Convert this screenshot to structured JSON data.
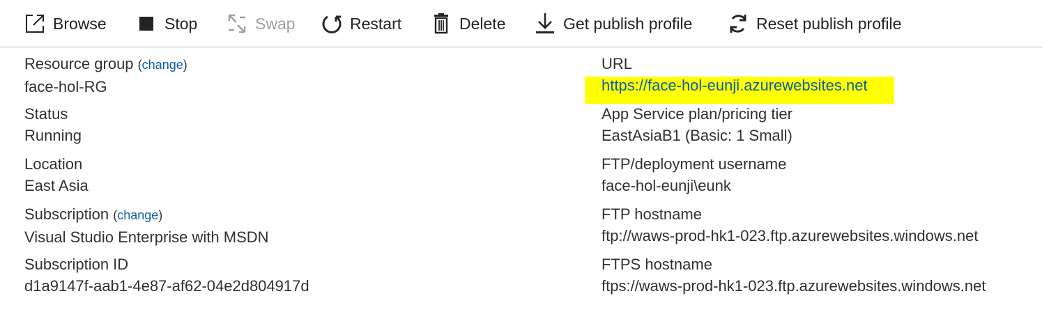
{
  "toolbar": {
    "browse": "Browse",
    "stop": "Stop",
    "swap": "Swap",
    "restart": "Restart",
    "delete": "Delete",
    "get_publish_profile": "Get publish profile",
    "reset_publish_profile": "Reset publish profile"
  },
  "essentials": {
    "left": {
      "resource_group_label": "Resource group",
      "resource_group_change": "change",
      "resource_group_value": "face-hol-RG",
      "status_label": "Status",
      "status_value": "Running",
      "location_label": "Location",
      "location_value": "East Asia",
      "subscription_label": "Subscription",
      "subscription_change": "change",
      "subscription_value": "Visual Studio Enterprise with MSDN",
      "subscription_id_label": "Subscription ID",
      "subscription_id_value": "d1a9147f-aab1-4e87-af62-04e2d804917d"
    },
    "right": {
      "url_label": "URL",
      "url_value": "https://face-hol-eunji.azurewebsites.net",
      "plan_label": "App Service plan/pricing tier",
      "plan_value": "EastAsiaB1 (Basic: 1 Small)",
      "ftp_user_label": "FTP/deployment username",
      "ftp_user_value": "face-hol-eunji\\eunk",
      "ftp_host_label": "FTP hostname",
      "ftp_host_value": "ftp://waws-prod-hk1-023.ftp.azurewebsites.windows.net",
      "ftps_host_label": "FTPS hostname",
      "ftps_host_value": "ftps://waws-prod-hk1-023.ftp.azurewebsites.windows.net"
    }
  },
  "colors": {
    "link": "#0a5fa8",
    "highlight": "#ffff00",
    "disabled": "#a19f9d"
  }
}
